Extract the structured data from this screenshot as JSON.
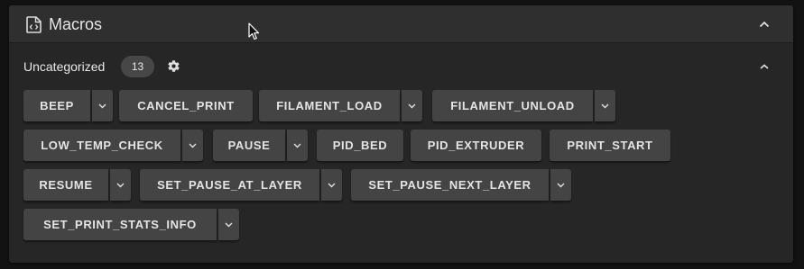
{
  "panel": {
    "title": "Macros",
    "icon": "file-code-icon"
  },
  "group": {
    "label": "Uncategorized",
    "count": "13"
  },
  "macros": [
    {
      "label": "BEEP",
      "dropdown": true
    },
    {
      "label": "CANCEL_PRINT",
      "dropdown": false
    },
    {
      "label": "FILAMENT_LOAD",
      "dropdown": true
    },
    {
      "label": "FILAMENT_UNLOAD",
      "dropdown": true
    },
    {
      "label": "LOW_TEMP_CHECK",
      "dropdown": true
    },
    {
      "label": "PAUSE",
      "dropdown": true
    },
    {
      "label": "PID_BED",
      "dropdown": false
    },
    {
      "label": "PID_EXTRUDER",
      "dropdown": false
    },
    {
      "label": "PRINT_START",
      "dropdown": false
    },
    {
      "label": "RESUME",
      "dropdown": true
    },
    {
      "label": "SET_PAUSE_AT_LAYER",
      "dropdown": true
    },
    {
      "label": "SET_PAUSE_NEXT_LAYER",
      "dropdown": true
    },
    {
      "label": "SET_PRINT_STATS_INFO",
      "dropdown": true
    }
  ],
  "colors": {
    "background": "#121212",
    "panel": "#262626",
    "button": "#444444",
    "text": "#e4e4e4"
  }
}
